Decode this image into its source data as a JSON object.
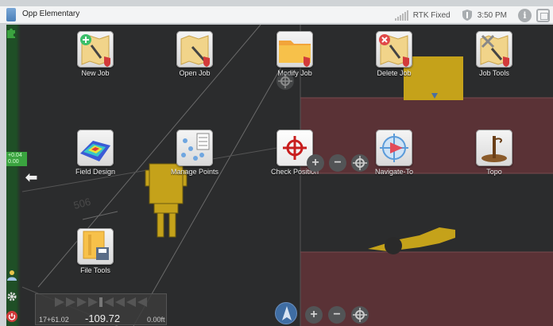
{
  "window": {
    "title": "Opp Elementary",
    "status_text": "RTK Fixed",
    "time": "3:50 PM",
    "info_glyph": "i"
  },
  "colors": {
    "map_bg": "#2b2c2d",
    "cut_fill_zone": "#5a3236",
    "machine_yellow": "#c5a21a",
    "rail_green": "#3aa33f"
  },
  "map": {
    "rail_value": "+0.04 0.00",
    "design_label": "506"
  },
  "tiles": [
    {
      "label": "New Job",
      "icon": "new-job-icon"
    },
    {
      "label": "Open Job",
      "icon": "open-job-icon"
    },
    {
      "label": "Modify Job",
      "icon": "modify-job-icon"
    },
    {
      "label": "Delete Job",
      "icon": "delete-job-icon"
    },
    {
      "label": "Job Tools",
      "icon": "job-tools-icon"
    },
    {
      "label": "Field Design",
      "icon": "field-design-icon"
    },
    {
      "label": "Manage Points",
      "icon": "manage-points-icon"
    },
    {
      "label": "Check Position",
      "icon": "check-position-icon"
    },
    {
      "label": "Navigate-To",
      "icon": "navigate-to-icon"
    },
    {
      "label": "Topo",
      "icon": "topo-icon"
    },
    {
      "label": "File Tools",
      "icon": "file-tools-icon"
    }
  ],
  "readout": {
    "station": "17+61.02",
    "value": "-109.72",
    "offset": "0.00ft"
  },
  "zoom": {
    "plus": "+",
    "minus": "−"
  }
}
